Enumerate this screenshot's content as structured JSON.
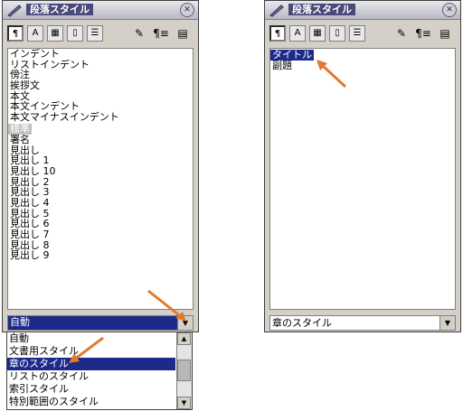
{
  "left_window": {
    "title": "段落スタイル",
    "styles": [
      "インデント",
      "リストインデント",
      "傍注",
      "挨拶文",
      "本文",
      "本文インデント",
      "本文マイナスインデント",
      "標準",
      "署名",
      "見出し",
      "見出し 1",
      "見出し 10",
      "見出し 2",
      "見出し 3",
      "見出し 4",
      "見出し 5",
      "見出し 6",
      "見出し 7",
      "見出し 8",
      "見出し 9"
    ],
    "filter_value": "自動",
    "dropdown_options": [
      "自動",
      "文書用スタイル",
      "章のスタイル",
      "リストのスタイル",
      "索引スタイル",
      "特別範囲のスタイル"
    ]
  },
  "right_window": {
    "title": "段落スタイル",
    "styles": [
      "タイトル",
      "副題"
    ],
    "filter_value": "章のスタイル"
  },
  "toolbar": {
    "paragraph_glyph": "¶",
    "character_glyph": "A",
    "brush_glyph": "✎"
  },
  "colors": {
    "selection": "#1c2a8a",
    "arrow": "#e07a30",
    "title_bg": "#4a4a7a"
  }
}
